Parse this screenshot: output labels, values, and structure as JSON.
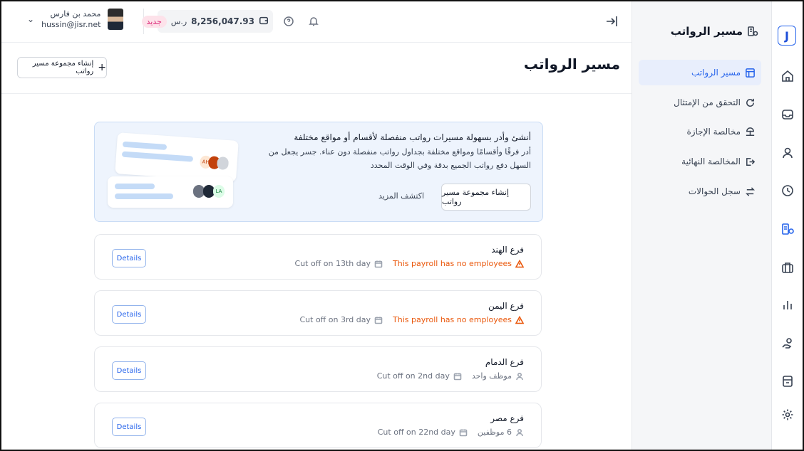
{
  "app": {
    "logo_letter": "J",
    "module_title": "مسير الرواتب"
  },
  "sidebar": {
    "items": [
      {
        "label": "مسير الرواتب",
        "icon": "table-icon",
        "active": true
      },
      {
        "label": "التحقق من الإمتثال",
        "icon": "refresh-icon",
        "active": false
      },
      {
        "label": "مخالصة الإجازة",
        "icon": "beach-icon",
        "active": false
      },
      {
        "label": "المخالصة النهائية",
        "icon": "exit-icon",
        "active": false
      },
      {
        "label": "سجل الحوالات",
        "icon": "transfer-icon",
        "active": false
      }
    ]
  },
  "rail": {
    "icons": [
      "home-icon",
      "inbox-icon",
      "user-icon",
      "clock-icon",
      "payroll-icon",
      "briefcase-icon",
      "chart-icon",
      "hand-coin-icon",
      "archive-icon",
      "settings-icon"
    ],
    "active": "payroll-icon"
  },
  "topbar": {
    "balance": "8,256,047.93",
    "currency": "ر.س",
    "new_badge": "جديد",
    "user_name": "محمد بن فارس",
    "user_email": "hussin@jisr.net"
  },
  "page": {
    "title": "مسير الرواتب",
    "create_group_label": "إنشاء مجموعة مسير رواتب"
  },
  "banner": {
    "title": "أنشئ وأدر بسهولة مسيرات رواتب منفصلة لأقسام أو مواقع مختلفة",
    "description": "أدر فرقًا وأقسامًا ومواقع مختلفة بجداول رواتب منفصلة دون عناء. جسر يجعل من السهل دفع رواتب الجميع بدقة وفي الوقت المحدد",
    "button_label": "إنشاء مجموعة مسير رواتب",
    "link_label": "اكتشف المزيد",
    "avatar_initials_1": "AH",
    "avatar_initials_2": "LA"
  },
  "payrolls": [
    {
      "name": "فرع الهند",
      "status": "This payroll has no employees",
      "warn": true,
      "cutoff": "Cut off on 13th day",
      "details": "Details"
    },
    {
      "name": "فرع اليمن",
      "status": "This payroll has no employees",
      "warn": true,
      "cutoff": "Cut off on 3rd day",
      "details": "Details"
    },
    {
      "name": "فرع الدمام",
      "status": "موظف واحد",
      "warn": false,
      "cutoff": "Cut off on 2nd day",
      "details": "Details"
    },
    {
      "name": "فرع مصر",
      "status": "6 موظفين",
      "warn": false,
      "cutoff": "Cut off on 22nd day",
      "details": "Details"
    }
  ]
}
